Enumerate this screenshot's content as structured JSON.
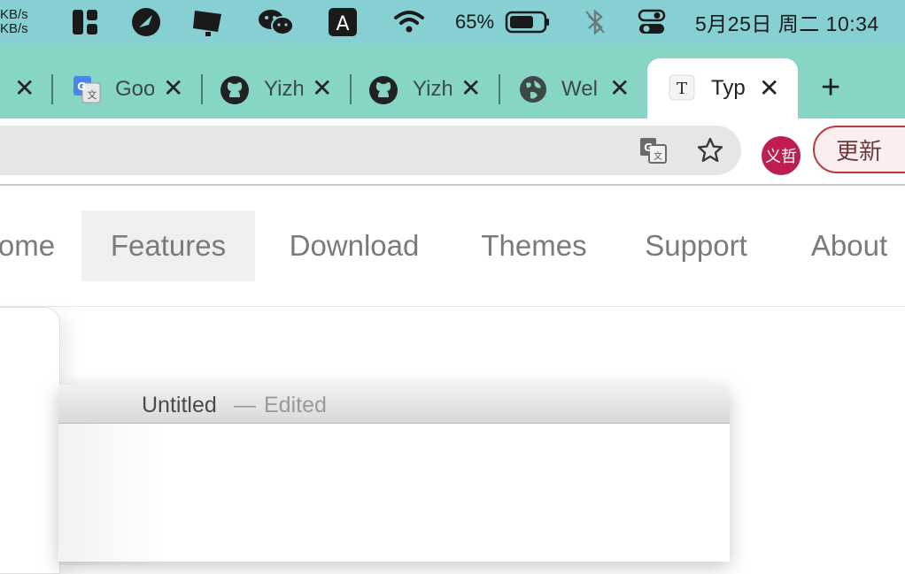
{
  "menubar": {
    "net_up": "KB/s",
    "net_down": "KB/s",
    "battery_percent": "65%",
    "clock": "5月25日 周二 10:34"
  },
  "tabs": [
    {
      "title": "",
      "icon": "generic-tab-icon"
    },
    {
      "title": "Goo",
      "icon": "google-translate-icon"
    },
    {
      "title": "Yizh",
      "icon": "github-icon"
    },
    {
      "title": "Yizh",
      "icon": "github-icon"
    },
    {
      "title": "Wel",
      "icon": "globe-icon"
    },
    {
      "title": "Typ",
      "icon": "typora-icon",
      "active": true
    }
  ],
  "toolbar": {
    "profile_label": "义哲",
    "update_label": "更新"
  },
  "sitenav": {
    "items": [
      "ome",
      "Features",
      "Download",
      "Themes",
      "Support",
      "About"
    ],
    "selected": "Features"
  },
  "preview": {
    "doc_title": "Untitled",
    "dash": "—",
    "doc_status": "Edited"
  },
  "colors": {
    "menubar_bg": "#86cfd3",
    "tabstrip_bg": "#86d5c5",
    "profile_bg": "#be1f4f",
    "update_border": "#b73b3b"
  }
}
